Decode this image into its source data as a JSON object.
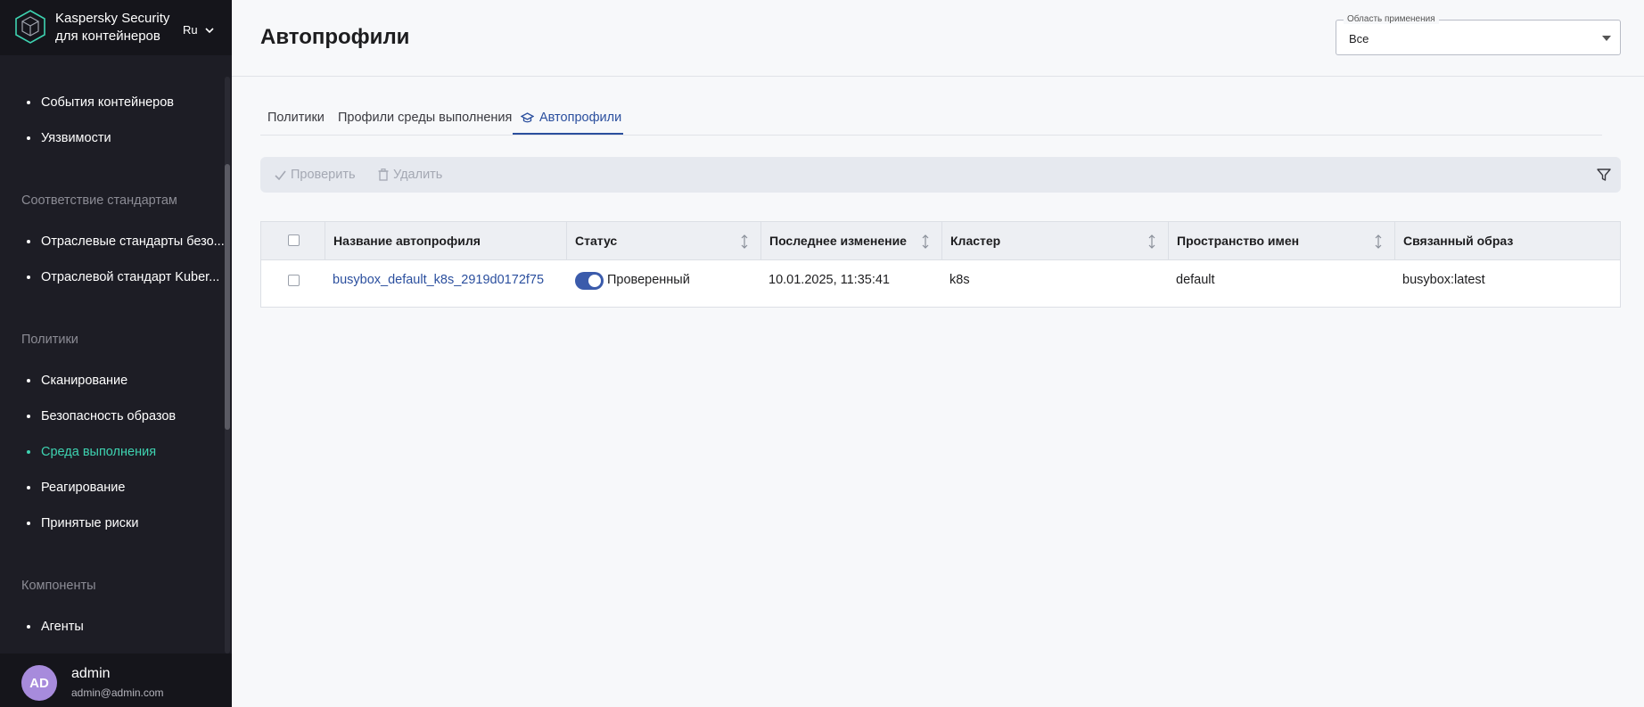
{
  "app": {
    "brand_line1": "Kaspersky Security",
    "brand_line2": "для контейнеров",
    "language": "Ru"
  },
  "sidebar": {
    "items_top": [
      {
        "label": "События контейнеров"
      },
      {
        "label": "Уязвимости"
      }
    ],
    "section_compliance": "Соответствие стандартам",
    "items_compliance": [
      {
        "label": "Отраслевые стандарты безо..."
      },
      {
        "label": "Отраслевой стандарт Kuber..."
      }
    ],
    "section_policies": "Политики",
    "items_policies": [
      {
        "label": "Сканирование"
      },
      {
        "label": "Безопасность образов"
      },
      {
        "label": "Среда выполнения",
        "active": true
      },
      {
        "label": "Реагирование"
      },
      {
        "label": "Принятые риски"
      }
    ],
    "section_components": "Компоненты",
    "items_components": [
      {
        "label": "Агенты"
      }
    ]
  },
  "user": {
    "initials": "AD",
    "name": "admin",
    "email": "admin@admin.com"
  },
  "header": {
    "title": "Автопрофили",
    "scope_label": "Область применения",
    "scope_value": "Все"
  },
  "tabs": [
    {
      "label": "Политики"
    },
    {
      "label": "Профили среды выполнения"
    },
    {
      "label": "Автопрофили",
      "active": true
    }
  ],
  "toolbar": {
    "check_label": "Проверить",
    "delete_label": "Удалить"
  },
  "table": {
    "columns": [
      "Название автопрофиля",
      "Статус",
      "Последнее изменение",
      "Кластер",
      "Пространство имен",
      "Связанный образ"
    ],
    "rows": [
      {
        "name": "busybox_default_k8s_2919d0172f75",
        "status": "Проверенный",
        "status_enabled": true,
        "modified": "10.01.2025, 11:35:41",
        "cluster": "k8s",
        "namespace": "default",
        "image": "busybox:latest"
      }
    ]
  },
  "colors": {
    "accent": "#2b4f9e",
    "active_nav": "#3ed3b1",
    "sidebar_bg": "#1d1d25",
    "avatar": "#a78bdc"
  }
}
